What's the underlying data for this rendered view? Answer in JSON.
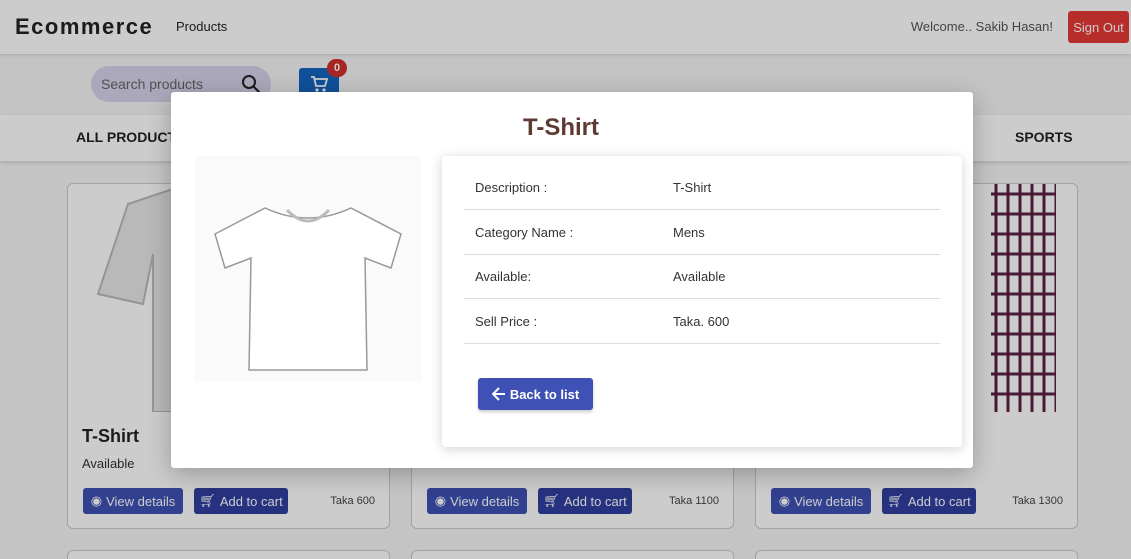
{
  "header": {
    "brand": "Ecommerce",
    "nav_products": "Products",
    "welcome": "Welcome.. Sakib Hasan!",
    "sign_out": "Sign Out"
  },
  "search": {
    "placeholder": "Search products"
  },
  "cart": {
    "count": "0"
  },
  "categories": {
    "all": "ALL PRODUCT",
    "sports": "SPORTS"
  },
  "products": [
    {
      "name": "T-Shirt",
      "status": "Available",
      "view": "View details",
      "add": "Add to cart",
      "price": "Taka 600"
    },
    {
      "view": "View details",
      "add": "Add to cart",
      "price": "Taka 1100"
    },
    {
      "view": "View details",
      "add": "Add to cart",
      "price": "Taka 1300"
    }
  ],
  "modal": {
    "title": "T-Shirt",
    "details": [
      {
        "label": "Description :",
        "value": "T-Shirt"
      },
      {
        "label": "Category Name :",
        "value": "Mens"
      },
      {
        "label": "Available:",
        "value": "Available"
      },
      {
        "label": "Sell Price :",
        "value": "Taka. 600"
      }
    ],
    "back_label": "Back to list"
  },
  "colors": {
    "primary": "#3f51b5",
    "danger": "#e53935",
    "cart": "#1565c0",
    "title": "#5d3a32"
  }
}
